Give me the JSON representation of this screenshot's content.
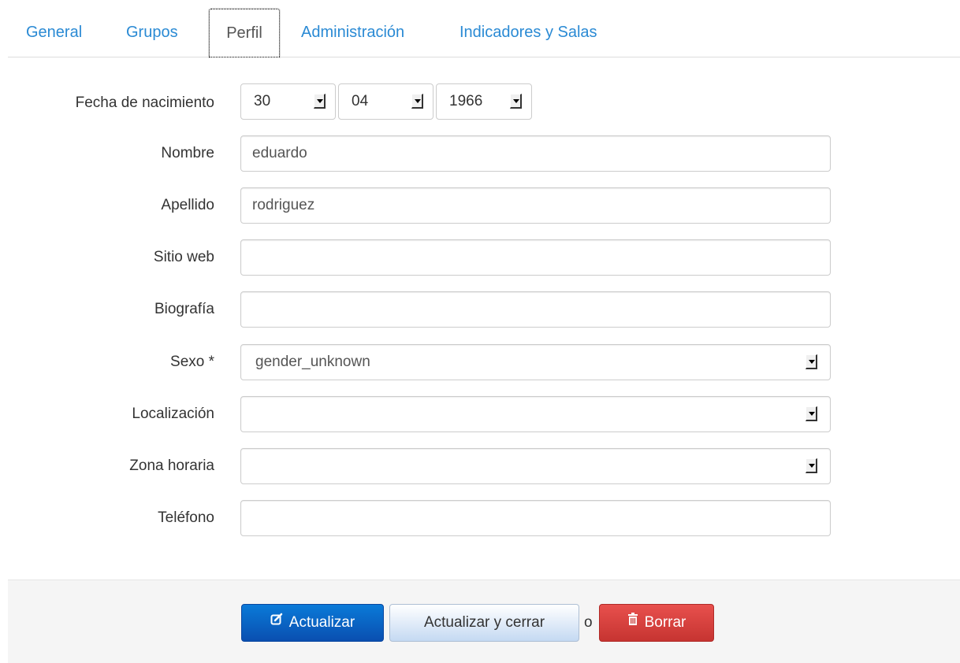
{
  "tabs": [
    {
      "label": "General"
    },
    {
      "label": "Grupos"
    },
    {
      "label": "Perfil"
    },
    {
      "label": "Administración"
    },
    {
      "label": "Indicadores y Salas"
    }
  ],
  "active_tab": "Perfil",
  "form": {
    "birthdate": {
      "label": "Fecha de nacimiento",
      "day": "30",
      "month": "04",
      "year": "1966"
    },
    "first_name": {
      "label": "Nombre",
      "value": "eduardo"
    },
    "last_name": {
      "label": "Apellido",
      "value": "rodriguez"
    },
    "website": {
      "label": "Sitio web",
      "value": ""
    },
    "bio": {
      "label": "Biografía",
      "value": ""
    },
    "gender": {
      "label": "Sexo *",
      "value": "gender_unknown"
    },
    "location": {
      "label": "Localización",
      "value": ""
    },
    "timezone": {
      "label": "Zona horaria",
      "value": ""
    },
    "phone": {
      "label": "Teléfono",
      "value": ""
    }
  },
  "actions": {
    "update_label": "Actualizar",
    "update_close_label": "Actualizar y cerrar",
    "separator": "o",
    "delete_label": "Borrar"
  },
  "icons": {
    "update": "edit-icon",
    "delete": "trash-icon"
  },
  "colors": {
    "link": "#2a8ad4",
    "primary": "#0a5fc4",
    "danger": "#d43f3a",
    "footer_bg": "#f5f5f5"
  }
}
